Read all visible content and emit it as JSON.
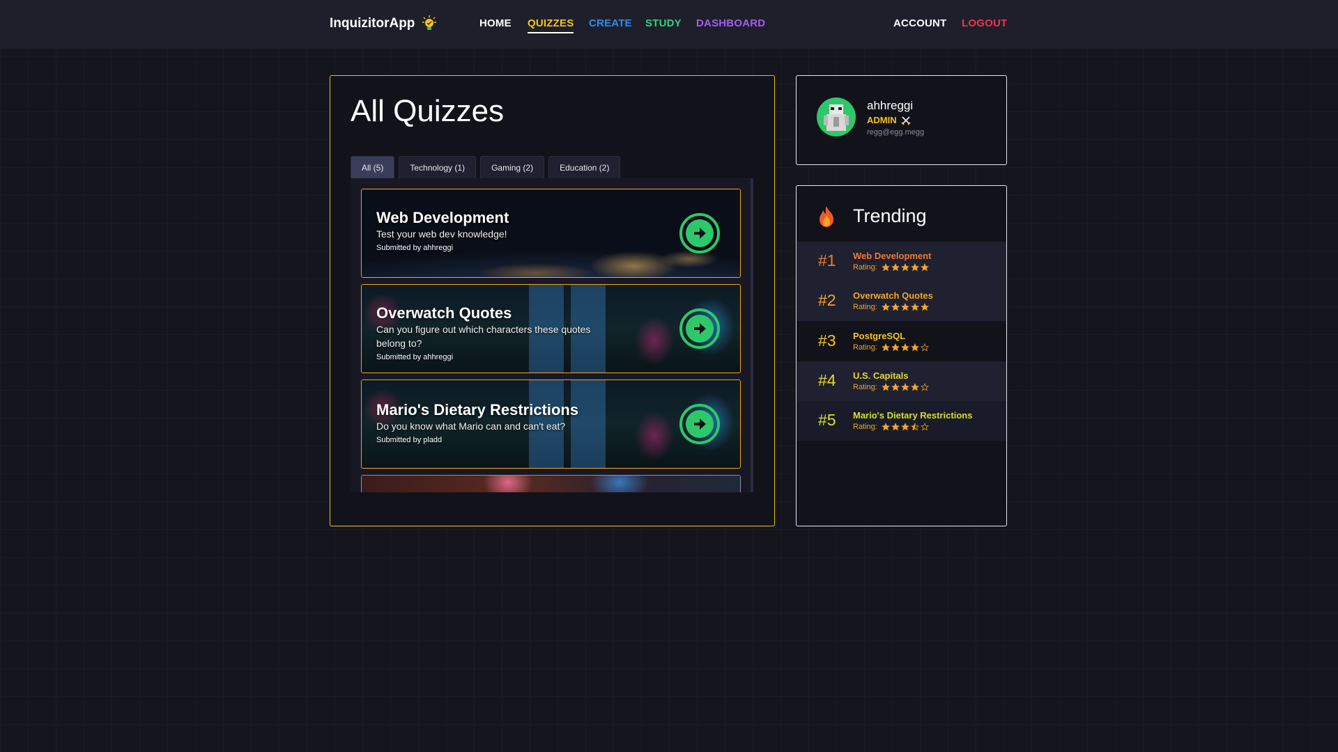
{
  "nav": {
    "brand": "InquizitorApp",
    "home": "HOME",
    "quizzes": "QUIZZES",
    "create": "CREATE",
    "study": "STUDY",
    "dashboard": "DASHBOARD",
    "account": "ACCOUNT",
    "logout": "LOGOUT"
  },
  "main": {
    "title": "All Quizzes",
    "tabs": [
      {
        "label": "All (5)",
        "active": true
      },
      {
        "label": "Technology (1)"
      },
      {
        "label": "Gaming (2)"
      },
      {
        "label": "Education (2)"
      }
    ],
    "quizzes": [
      {
        "title": "Web Development",
        "description": "Test your web dev knowledge!",
        "submitted_by": "Submitted by ahhreggi",
        "image": "earth-at-night"
      },
      {
        "title": "Overwatch Quotes",
        "description": "Can you figure out which characters these quotes belong to?",
        "submitted_by": "Submitted by ahhreggi",
        "image": "arcade"
      },
      {
        "title": "Mario's Dietary Restrictions",
        "description": "Do you know what Mario can and can't eat?",
        "submitted_by": "Submitted by pladd",
        "image": "arcade"
      }
    ]
  },
  "profile": {
    "username": "ahhreggi",
    "role": "ADMIN",
    "email": "regg@egg.megg"
  },
  "trending": {
    "title": "Trending",
    "rating_label": "Rating:",
    "items": [
      {
        "rank": "#1",
        "name": "Web Development",
        "rating": 5,
        "color": "#f07a2e"
      },
      {
        "rank": "#2",
        "name": "Overwatch Quotes",
        "rating": 5,
        "color": "#f5a623"
      },
      {
        "rank": "#3",
        "name": "PostgreSQL",
        "rating": 4,
        "color": "#f5c518"
      },
      {
        "rank": "#4",
        "name": "U.S. Capitals",
        "rating": 4,
        "color": "#e8d82a"
      },
      {
        "rank": "#5",
        "name": "Mario's Dietary Restrictions",
        "rating": 3.5,
        "color": "#d4e02e"
      }
    ]
  },
  "colors": {
    "accent_gold": "#e2c227",
    "go_green": "#2ec86a",
    "star": "#f5a623"
  }
}
